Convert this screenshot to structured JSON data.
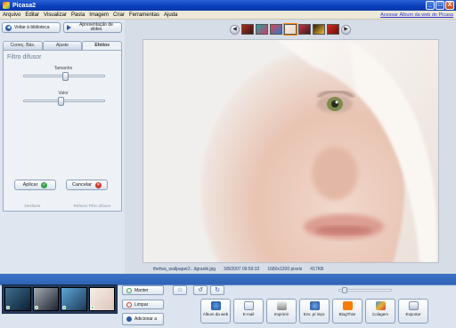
{
  "window": {
    "title": "Picasa2",
    "buttons": [
      "_",
      "□",
      "X"
    ]
  },
  "menu": {
    "items": [
      "Arquivo",
      "Editar",
      "Visualizar",
      "Pasta",
      "Imagem",
      "Criar",
      "Ferramentas",
      "Ajuda"
    ],
    "web_album_link": "Acessar Álbum da web do Picasa"
  },
  "left_panel": {
    "back_button": "Voltar à biblioteca",
    "slideshow_button": "Apresentação de slides",
    "tabs": [
      "Correç. Bás.",
      "Ajuste",
      "Efeitos"
    ],
    "active_tab": "Efeitos",
    "panel_title": "Filtro difusor",
    "slider1_label": "Tamanho",
    "slider1_value": 0.5,
    "slider2_label": "Valor",
    "slider2_value": 0.45,
    "apply_button": "Aplicar",
    "cancel_button": "Cancelar",
    "lower_buttons": [
      "Desfazer",
      "Refazer Filtro difusor"
    ]
  },
  "filmstrip": {
    "prev_icon": "left-arrow-icon",
    "next_icon": "right-arrow-icon"
  },
  "photo_info": {
    "filename": "thefwa_wallpaper2...ltgranik.jpg",
    "date": "3/8/2007 09:59:32",
    "dimensions": "1680x1200 pixels",
    "size": "417KB"
  },
  "tray": {
    "hold_button": "Manter",
    "clear_button": "Limpar",
    "add_button": "Adicionar a",
    "actions": [
      "Álbum da web",
      "E-mail",
      "Imprimir",
      "Env. p/ impr.",
      "BlogThis!",
      "Colagem",
      "Exportar"
    ]
  },
  "colors": {
    "titlebar": "#0a3fbb",
    "accent": "#2e63b6"
  }
}
